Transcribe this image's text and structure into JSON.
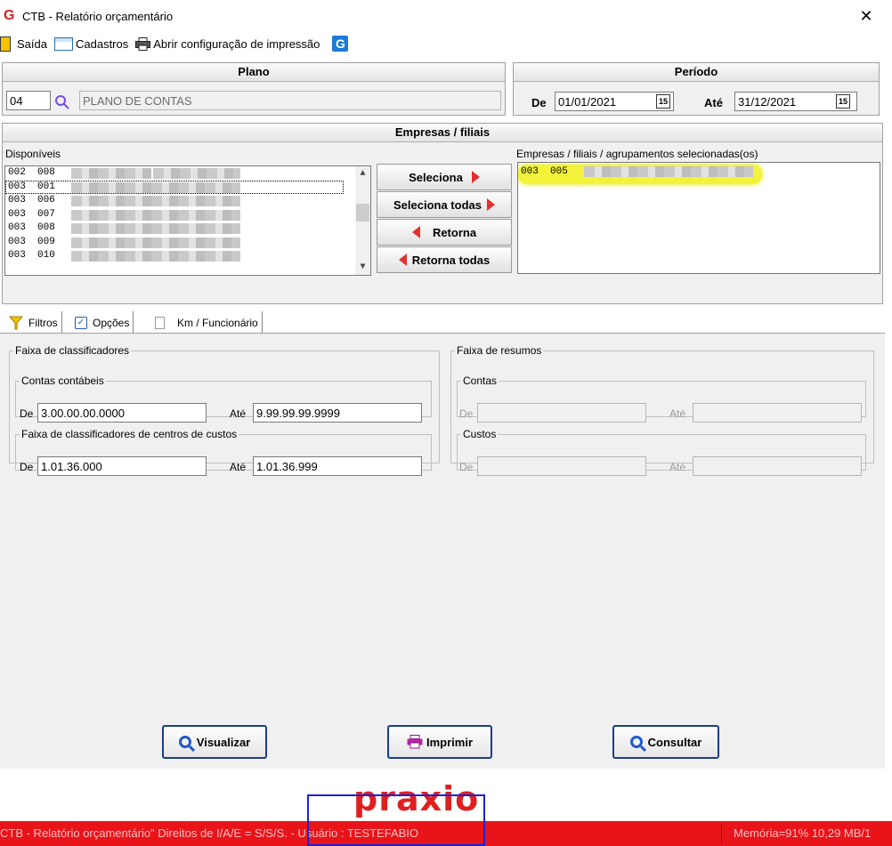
{
  "window": {
    "title": "CTB - Relatório orçamentário",
    "close": "✕"
  },
  "menu": {
    "saida": "Saída",
    "cadastros": "Cadastros",
    "impressao": "Abrir configuração de impressão"
  },
  "plano": {
    "header": "Plano",
    "code": "04",
    "description": "PLANO DE CONTAS"
  },
  "periodo": {
    "header": "Período",
    "de_label": "De",
    "de_value": "01/01/2021",
    "ate_label": "Até",
    "ate_value": "31/12/2021"
  },
  "empresas": {
    "header": "Empresas / filiais",
    "disponiveis_label": "Disponíveis",
    "selecionadas_label": "Empresas / filiais / agrupamentos selecionadas(os)",
    "disponiveis": [
      "002  008",
      "003  001",
      "003  006",
      "003  007",
      "003  008",
      "003  009",
      "003  010"
    ],
    "selecionadas": [
      "003  005"
    ],
    "highlight_color": "#f0f000"
  },
  "buttons": {
    "seleciona": "Seleciona",
    "seleciona_todas": "Seleciona todas",
    "retorna": "Retorna",
    "retorna_todas": "Retorna todas"
  },
  "tabs": [
    {
      "label": "Filtros",
      "icon": "filter-icon"
    },
    {
      "label": "Opções",
      "icon": "checkbox-icon"
    },
    {
      "label": "Km / Funcionário",
      "icon": "page-icon"
    }
  ],
  "filtros": {
    "faixa_classificadores": "Faixa de classificadores",
    "contas_contabeis": "Contas contábeis",
    "de_label": "De",
    "ate_label": "Até",
    "contas_de": "3.00.00.00.0000",
    "contas_ate": "9.99.99.99.9999",
    "centros_custos": "Faixa de classificadores de centros de custos",
    "custos_de": "1.01.36.000",
    "custos_ate": "1.01.36.999",
    "faixa_resumos": "Faixa de resumos",
    "contas": "Contas",
    "custos": "Custos"
  },
  "actions": {
    "visualizar": "Visualizar",
    "imprimir": "Imprimir",
    "consultar": "Consultar"
  },
  "logo": "praxio",
  "status": {
    "left": "CTB - Relatório orçamentário\" Direitos de I/A/E = S/S/S. - Usuário : TESTEFABIO",
    "right": "Memória=91% 10,29 MB/1"
  }
}
